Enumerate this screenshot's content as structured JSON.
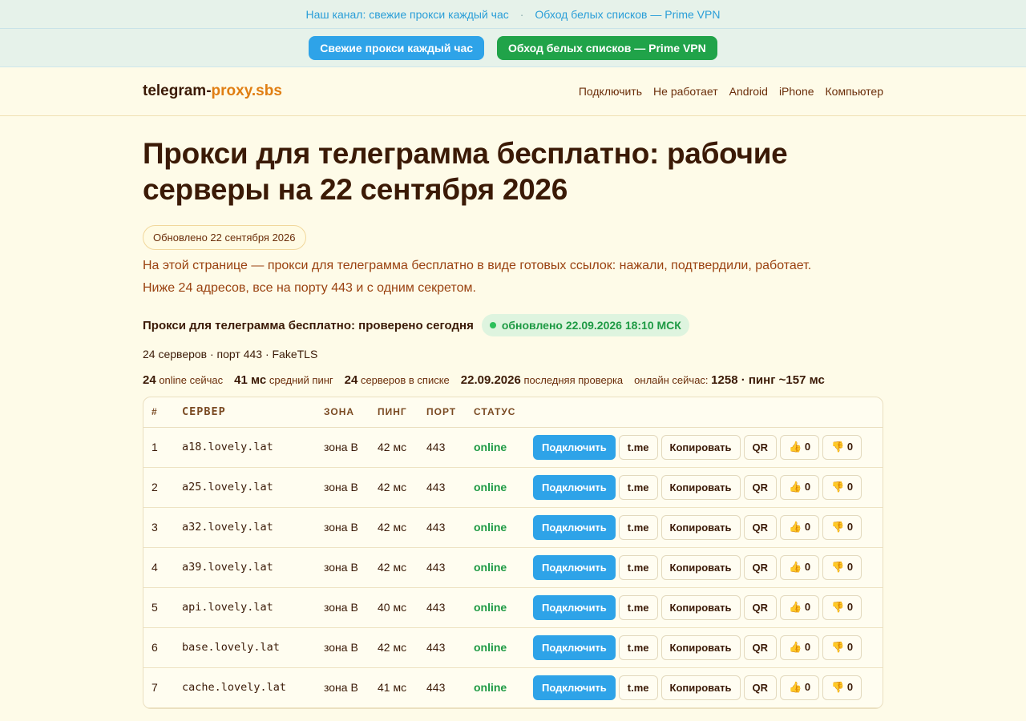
{
  "topbar": {
    "link1": "Наш канал: свежие прокси каждый час",
    "separator": "·",
    "link2": "Обход белых списков — Prime VPN"
  },
  "cta": {
    "proxy_button": "Свежие прокси каждый час",
    "vpn_button": "Обход белых списков — Prime VPN",
    "colors": {
      "blue": "#2ea3e8",
      "green": "#20a349"
    }
  },
  "header": {
    "logo_main": "telegram-",
    "logo_accent": "proxy.sbs",
    "nav": [
      "Подключить",
      "Не работает",
      "Android",
      "iPhone",
      "Компьютер"
    ]
  },
  "main": {
    "title": "Прокси для телеграмма бесплатно: рабочие серверы на 22 сентября 2026",
    "updated_pill": "Обновлено 22 сентября 2026",
    "intro_line1": "На этой странице — прокси для телеграмма бесплатно в виде готовых ссылок: нажали, подтвердили, работает.",
    "intro_line2": "Ниже 24 адресов, все на порту 443 и с одним секретом.",
    "section_title": "Прокси для телеграмма бесплатно: проверено сегодня",
    "fresh_badge": "обновлено 22.09.2026 18:10 МСК",
    "meta": "24 серверов · порт 443 · FakeTLS",
    "stats": {
      "online_value": "24",
      "online_label": "online сейчас",
      "ping_value": "41 мс",
      "ping_label": "средний пинг",
      "servers_value": "24",
      "servers_label": "серверов в списке",
      "check_value": "22.09.2026",
      "check_label": "последняя проверка",
      "now_label": "онлайн сейчас:",
      "now_value": "1258 · пинг ~157 мс"
    }
  },
  "table": {
    "headers": [
      "#",
      "СЕРВЕР",
      "ЗОНА",
      "ПИНГ",
      "ПОРТ",
      "СТАТУС"
    ],
    "actions": {
      "connect": "Подключить",
      "tme": "t.me",
      "copy": "Копировать",
      "qr": "QR",
      "like": "👍 0",
      "dislike": "👎 0"
    },
    "rows": [
      {
        "num": "1",
        "server": "a18.lovely.lat",
        "zone": "зона B",
        "ping": "42 мс",
        "port": "443",
        "status": "online"
      },
      {
        "num": "2",
        "server": "a25.lovely.lat",
        "zone": "зона B",
        "ping": "42 мс",
        "port": "443",
        "status": "online"
      },
      {
        "num": "3",
        "server": "a32.lovely.lat",
        "zone": "зона B",
        "ping": "42 мс",
        "port": "443",
        "status": "online"
      },
      {
        "num": "4",
        "server": "a39.lovely.lat",
        "zone": "зона B",
        "ping": "42 мс",
        "port": "443",
        "status": "online"
      },
      {
        "num": "5",
        "server": "api.lovely.lat",
        "zone": "зона B",
        "ping": "40 мс",
        "port": "443",
        "status": "online"
      },
      {
        "num": "6",
        "server": "base.lovely.lat",
        "zone": "зона B",
        "ping": "42 мс",
        "port": "443",
        "status": "online"
      },
      {
        "num": "7",
        "server": "cache.lovely.lat",
        "zone": "зона B",
        "ping": "41 мс",
        "port": "443",
        "status": "online"
      }
    ]
  }
}
